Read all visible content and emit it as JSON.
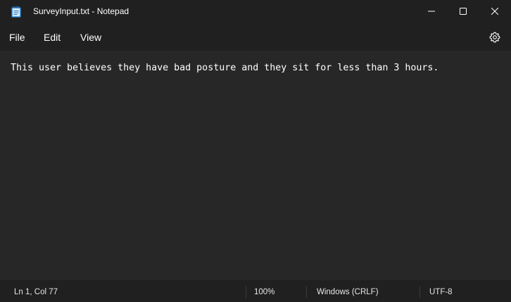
{
  "window": {
    "title": "SurveyInput.txt - Notepad"
  },
  "menu": {
    "file": "File",
    "edit": "Edit",
    "view": "View"
  },
  "editor": {
    "content": "This user believes they have bad posture and they sit for less than 3 hours."
  },
  "status": {
    "position": "Ln 1, Col 77",
    "zoom": "100%",
    "line_ending": "Windows (CRLF)",
    "encoding": "UTF-8"
  },
  "icons": {
    "app": "notepad-icon",
    "minimize": "minimize-icon",
    "maximize": "maximize-icon",
    "close": "close-icon",
    "settings": "gear-icon"
  },
  "colors": {
    "chrome": "#202020",
    "editor_bg": "#272727",
    "notepad_icon_blue": "#4aa3ee"
  }
}
